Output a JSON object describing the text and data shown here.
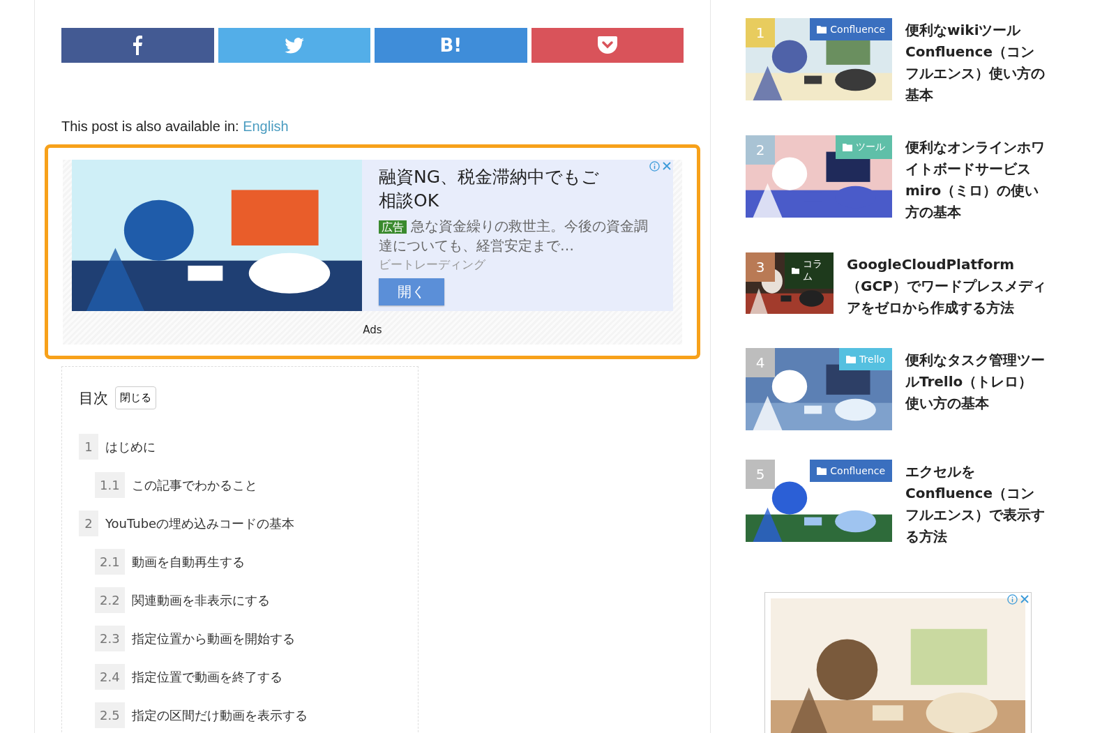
{
  "share_buttons": [
    {
      "kind": "facebook",
      "color": "#435a93"
    },
    {
      "kind": "twitter",
      "color": "#53aee8"
    },
    {
      "kind": "hatena",
      "label": "B!",
      "color": "#3f8dd9"
    },
    {
      "kind": "pocket",
      "color": "#d9535a"
    }
  ],
  "language_notice": {
    "text": "This post is also available in: ",
    "link": "English"
  },
  "ad": {
    "headline": "融資NG、税金滞納中でもご相談OK",
    "badge": "広告",
    "description": "急な資金繰りの救世主。今後の資金調達についても、経営安定まで…",
    "advertiser": "ビートレーディング",
    "button": "開く",
    "footer": "Ads"
  },
  "toc": {
    "title": "目次",
    "toggle": "閉じる",
    "items": [
      {
        "number": "1",
        "label": "はじめに",
        "children": [
          {
            "number": "1.1",
            "label": "この記事でわかること"
          }
        ]
      },
      {
        "number": "2",
        "label": "YouTubeの埋め込みコードの基本",
        "children": [
          {
            "number": "2.1",
            "label": "動画を自動再生する"
          },
          {
            "number": "2.2",
            "label": "関連動画を非表示にする"
          },
          {
            "number": "2.3",
            "label": "指定位置から動画を開始する"
          },
          {
            "number": "2.4",
            "label": "指定位置で動画を終了する"
          },
          {
            "number": "2.5",
            "label": "指定の区間だけ動画を表示する"
          }
        ]
      }
    ]
  },
  "ranking": [
    {
      "rank": {
        "label": "1",
        "color": "#e8cc5e"
      },
      "category": {
        "label": "Confluence",
        "color": "#3a6fbf"
      },
      "title": "便利なwikiツールConfluence（コンフルエンス）使い方の基本",
      "kind": "large"
    },
    {
      "rank": {
        "label": "2",
        "color": "#a9c3d4"
      },
      "category": {
        "label": "ツール",
        "color": "#5fbfa8"
      },
      "title": "便利なオンラインホワイトボードサービスmiro（ミロ）の使い方の基本",
      "kind": "large"
    },
    {
      "rank": {
        "label": "3",
        "color": "#b97a55"
      },
      "category": {
        "label": "コラム",
        "color": "#1e3a1c"
      },
      "title": "GoogleCloudPlatform（GCP）でワードプレスメディアをゼロから作成する方法",
      "kind": "small"
    },
    {
      "rank": {
        "label": "4",
        "color": "#bdbdbd"
      },
      "category": {
        "label": "Trello",
        "color": "#55c0e0"
      },
      "title": "便利なタスク管理ツールTrello（トレロ）使い方の基本",
      "kind": "large"
    },
    {
      "rank": {
        "label": "5",
        "color": "#bdbdbd"
      },
      "category": {
        "label": "Confluence",
        "color": "#3a6fbf"
      },
      "title": "エクセルをConfluence（コンフルエンス）で表示する方法",
      "kind": "large"
    }
  ]
}
